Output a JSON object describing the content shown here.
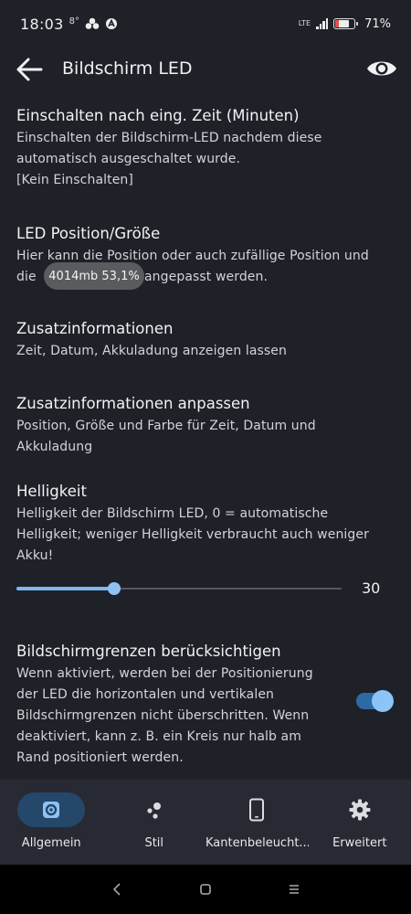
{
  "statusbar": {
    "time": "18:03",
    "indicator": "8°",
    "network": "LTE",
    "battery": "71%",
    "icons": [
      "cloud-icon",
      "app-badge-icon",
      "signal-icon",
      "battery-icon"
    ]
  },
  "appbar": {
    "title": "Bildschirm LED",
    "icons": [
      "back-arrow-icon",
      "eye-icon"
    ]
  },
  "settings": [
    {
      "title": "Einschalten nach eing. Zeit (Minuten)",
      "lines": [
        "Einschalten der Bildschirm-LED nachdem diese",
        "automatisch ausgeschaltet wurde.",
        "[Kein Einschalten]"
      ]
    },
    {
      "title": "LED Position/Größe",
      "lines": [
        "Hier kann die Position oder auch zufällige Position und",
        "die                          angepasst werden."
      ]
    },
    {
      "title": "Zusatzinformationen",
      "lines": [
        "Zeit, Datum, Akkuladung anzeigen lassen"
      ]
    },
    {
      "title": "Zusatzinformationen anpassen",
      "lines": [
        "Position, Größe und Farbe für Zeit, Datum und",
        "Akkuladung"
      ]
    },
    {
      "title": "Helligkeit",
      "lines": [
        "Helligkeit der Bildschirm LED, 0 = automatische",
        "Helligkeit; weniger Helligkeit verbraucht auch weniger",
        "Akku!"
      ]
    },
    {
      "title": "Bildschirmgrenzen berücksichtigen",
      "lines": [
        "Wenn aktiviert, werden bei der Positionierung",
        "der LED die horizontalen und vertikalen",
        "Bildschirmgrenzen nicht überschritten. Wenn",
        "deaktiviert, kann z. B. ein Kreis nur halb am",
        "Rand positioniert werden."
      ]
    }
  ],
  "toast": "4014mb 53,1%",
  "brightness": {
    "value": "30",
    "fraction": 0.3
  },
  "screen_bounds_toggle": {
    "on": true
  },
  "colors": {
    "accent": "#8ec2f5",
    "toggle_track": "#2d6aa4",
    "nav_active": "#24476a",
    "background": "#1f2128"
  },
  "bottomnav": [
    {
      "label": "Allgemein",
      "icon": "gear-badge-icon",
      "active": true
    },
    {
      "label": "Stil",
      "icon": "dots-icon",
      "active": false
    },
    {
      "label": "Kantenbeleucht...",
      "icon": "phone-icon",
      "active": false
    },
    {
      "label": "Erweitert",
      "icon": "gear-icon",
      "active": false
    }
  ]
}
